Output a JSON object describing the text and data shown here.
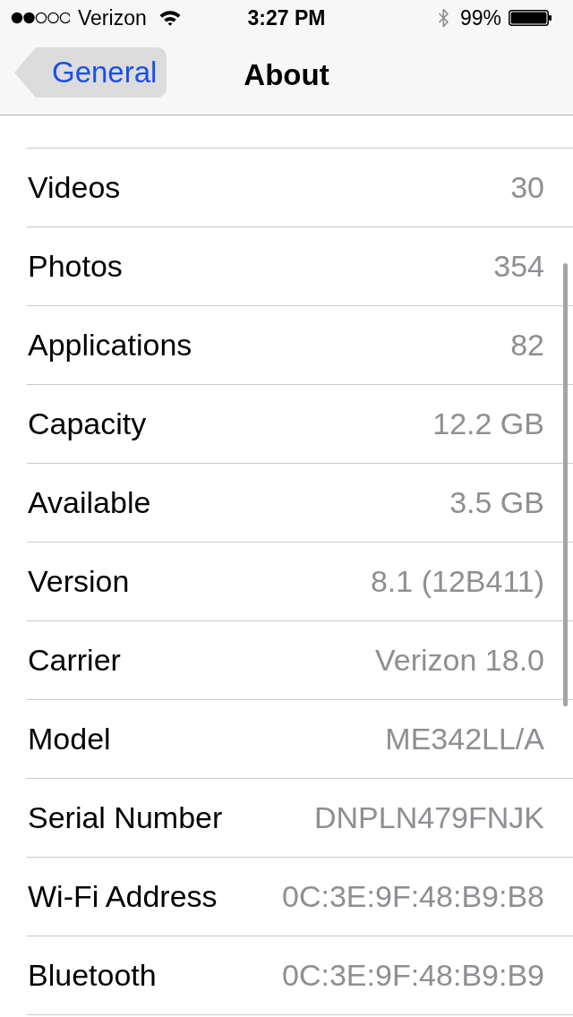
{
  "status_bar": {
    "carrier": "Verizon",
    "time": "3:27 PM",
    "battery_percent": "99%"
  },
  "nav_bar": {
    "back_button": "General",
    "title": "About"
  },
  "rows": [
    {
      "label": "Videos",
      "value": "30"
    },
    {
      "label": "Photos",
      "value": "354"
    },
    {
      "label": "Applications",
      "value": "82"
    },
    {
      "label": "Capacity",
      "value": "12.2 GB"
    },
    {
      "label": "Available",
      "value": "3.5 GB"
    },
    {
      "label": "Version",
      "value": "8.1 (12B411)"
    },
    {
      "label": "Carrier",
      "value": "Verizon 18.0"
    },
    {
      "label": "Model",
      "value": "ME342LL/A"
    },
    {
      "label": "Serial Number",
      "value": "DNPLN479FNJK"
    },
    {
      "label": "Wi-Fi Address",
      "value": "0C:3E:9F:48:B9:B8"
    },
    {
      "label": "Bluetooth",
      "value": "0C:3E:9F:48:B9:B9"
    }
  ]
}
